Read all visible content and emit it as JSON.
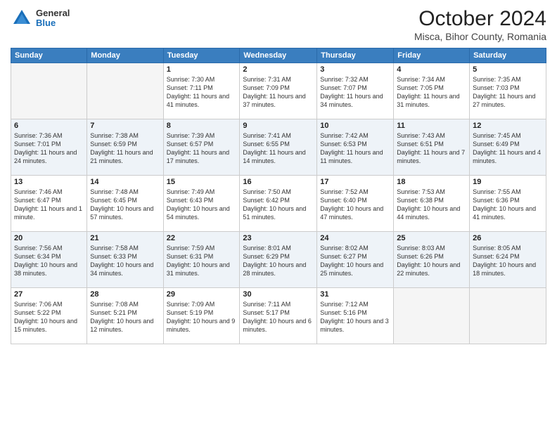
{
  "header": {
    "logo_general": "General",
    "logo_blue": "Blue",
    "month_title": "October 2024",
    "location": "Misca, Bihor County, Romania"
  },
  "weekdays": [
    "Sunday",
    "Monday",
    "Tuesday",
    "Wednesday",
    "Thursday",
    "Friday",
    "Saturday"
  ],
  "rows": [
    {
      "alt": false,
      "days": [
        {
          "num": "",
          "info": "",
          "empty": true
        },
        {
          "num": "",
          "info": "",
          "empty": true
        },
        {
          "num": "1",
          "info": "Sunrise: 7:30 AM\nSunset: 7:11 PM\nDaylight: 11 hours and 41 minutes.",
          "empty": false
        },
        {
          "num": "2",
          "info": "Sunrise: 7:31 AM\nSunset: 7:09 PM\nDaylight: 11 hours and 37 minutes.",
          "empty": false
        },
        {
          "num": "3",
          "info": "Sunrise: 7:32 AM\nSunset: 7:07 PM\nDaylight: 11 hours and 34 minutes.",
          "empty": false
        },
        {
          "num": "4",
          "info": "Sunrise: 7:34 AM\nSunset: 7:05 PM\nDaylight: 11 hours and 31 minutes.",
          "empty": false
        },
        {
          "num": "5",
          "info": "Sunrise: 7:35 AM\nSunset: 7:03 PM\nDaylight: 11 hours and 27 minutes.",
          "empty": false
        }
      ]
    },
    {
      "alt": true,
      "days": [
        {
          "num": "6",
          "info": "Sunrise: 7:36 AM\nSunset: 7:01 PM\nDaylight: 11 hours and 24 minutes.",
          "empty": false
        },
        {
          "num": "7",
          "info": "Sunrise: 7:38 AM\nSunset: 6:59 PM\nDaylight: 11 hours and 21 minutes.",
          "empty": false
        },
        {
          "num": "8",
          "info": "Sunrise: 7:39 AM\nSunset: 6:57 PM\nDaylight: 11 hours and 17 minutes.",
          "empty": false
        },
        {
          "num": "9",
          "info": "Sunrise: 7:41 AM\nSunset: 6:55 PM\nDaylight: 11 hours and 14 minutes.",
          "empty": false
        },
        {
          "num": "10",
          "info": "Sunrise: 7:42 AM\nSunset: 6:53 PM\nDaylight: 11 hours and 11 minutes.",
          "empty": false
        },
        {
          "num": "11",
          "info": "Sunrise: 7:43 AM\nSunset: 6:51 PM\nDaylight: 11 hours and 7 minutes.",
          "empty": false
        },
        {
          "num": "12",
          "info": "Sunrise: 7:45 AM\nSunset: 6:49 PM\nDaylight: 11 hours and 4 minutes.",
          "empty": false
        }
      ]
    },
    {
      "alt": false,
      "days": [
        {
          "num": "13",
          "info": "Sunrise: 7:46 AM\nSunset: 6:47 PM\nDaylight: 11 hours and 1 minute.",
          "empty": false
        },
        {
          "num": "14",
          "info": "Sunrise: 7:48 AM\nSunset: 6:45 PM\nDaylight: 10 hours and 57 minutes.",
          "empty": false
        },
        {
          "num": "15",
          "info": "Sunrise: 7:49 AM\nSunset: 6:43 PM\nDaylight: 10 hours and 54 minutes.",
          "empty": false
        },
        {
          "num": "16",
          "info": "Sunrise: 7:50 AM\nSunset: 6:42 PM\nDaylight: 10 hours and 51 minutes.",
          "empty": false
        },
        {
          "num": "17",
          "info": "Sunrise: 7:52 AM\nSunset: 6:40 PM\nDaylight: 10 hours and 47 minutes.",
          "empty": false
        },
        {
          "num": "18",
          "info": "Sunrise: 7:53 AM\nSunset: 6:38 PM\nDaylight: 10 hours and 44 minutes.",
          "empty": false
        },
        {
          "num": "19",
          "info": "Sunrise: 7:55 AM\nSunset: 6:36 PM\nDaylight: 10 hours and 41 minutes.",
          "empty": false
        }
      ]
    },
    {
      "alt": true,
      "days": [
        {
          "num": "20",
          "info": "Sunrise: 7:56 AM\nSunset: 6:34 PM\nDaylight: 10 hours and 38 minutes.",
          "empty": false
        },
        {
          "num": "21",
          "info": "Sunrise: 7:58 AM\nSunset: 6:33 PM\nDaylight: 10 hours and 34 minutes.",
          "empty": false
        },
        {
          "num": "22",
          "info": "Sunrise: 7:59 AM\nSunset: 6:31 PM\nDaylight: 10 hours and 31 minutes.",
          "empty": false
        },
        {
          "num": "23",
          "info": "Sunrise: 8:01 AM\nSunset: 6:29 PM\nDaylight: 10 hours and 28 minutes.",
          "empty": false
        },
        {
          "num": "24",
          "info": "Sunrise: 8:02 AM\nSunset: 6:27 PM\nDaylight: 10 hours and 25 minutes.",
          "empty": false
        },
        {
          "num": "25",
          "info": "Sunrise: 8:03 AM\nSunset: 6:26 PM\nDaylight: 10 hours and 22 minutes.",
          "empty": false
        },
        {
          "num": "26",
          "info": "Sunrise: 8:05 AM\nSunset: 6:24 PM\nDaylight: 10 hours and 18 minutes.",
          "empty": false
        }
      ]
    },
    {
      "alt": false,
      "days": [
        {
          "num": "27",
          "info": "Sunrise: 7:06 AM\nSunset: 5:22 PM\nDaylight: 10 hours and 15 minutes.",
          "empty": false
        },
        {
          "num": "28",
          "info": "Sunrise: 7:08 AM\nSunset: 5:21 PM\nDaylight: 10 hours and 12 minutes.",
          "empty": false
        },
        {
          "num": "29",
          "info": "Sunrise: 7:09 AM\nSunset: 5:19 PM\nDaylight: 10 hours and 9 minutes.",
          "empty": false
        },
        {
          "num": "30",
          "info": "Sunrise: 7:11 AM\nSunset: 5:17 PM\nDaylight: 10 hours and 6 minutes.",
          "empty": false
        },
        {
          "num": "31",
          "info": "Sunrise: 7:12 AM\nSunset: 5:16 PM\nDaylight: 10 hours and 3 minutes.",
          "empty": false
        },
        {
          "num": "",
          "info": "",
          "empty": true
        },
        {
          "num": "",
          "info": "",
          "empty": true
        }
      ]
    }
  ]
}
